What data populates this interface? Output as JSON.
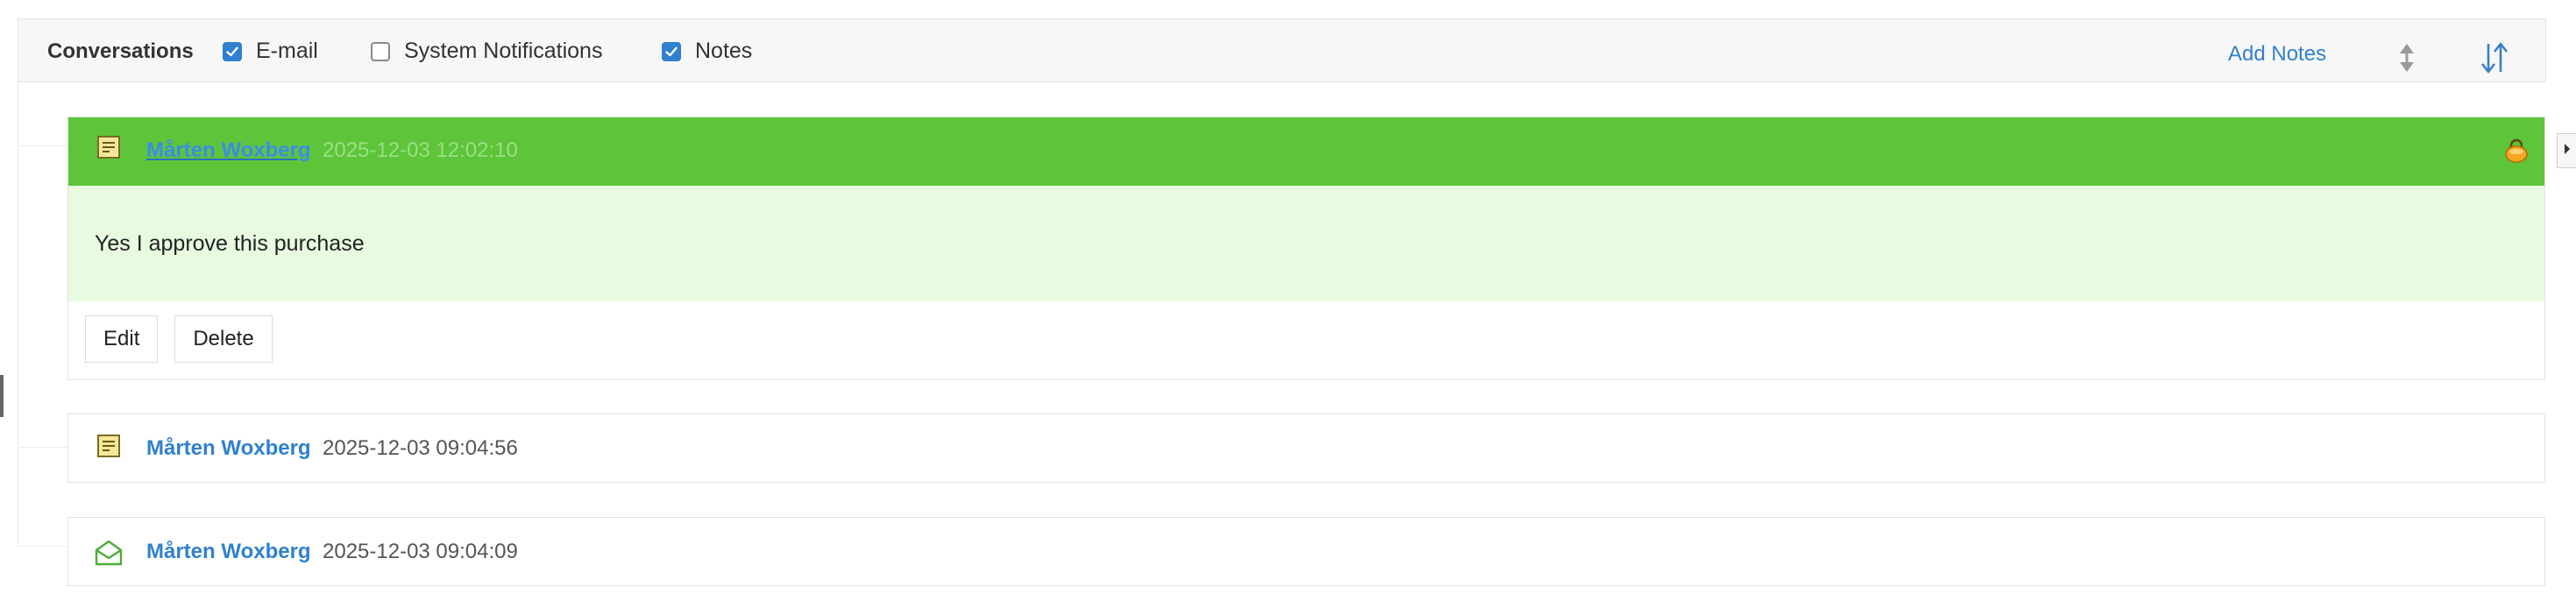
{
  "header": {
    "title": "Conversations",
    "filters": [
      {
        "label": "E-mail",
        "checked": true
      },
      {
        "label": "System Notifications",
        "checked": false
      },
      {
        "label": "Notes",
        "checked": true
      }
    ],
    "add_notes_label": "Add Notes",
    "sort_icon": "sort-up-down-icon",
    "order_icon": "sort-order-icon"
  },
  "conversations": [
    {
      "type": "note",
      "icon": "note-icon",
      "author": "Mårten Woxberg",
      "timestamp": "2025-12-03 12:02:10",
      "body": "Yes I approve this purchase",
      "expanded": true,
      "actions": {
        "edit_label": "Edit",
        "delete_label": "Delete"
      },
      "lock_icon": "lock-icon"
    },
    {
      "type": "note",
      "icon": "note-icon",
      "author": "Mårten Woxberg",
      "timestamp": "2025-12-03 09:04:56",
      "expanded": false
    },
    {
      "type": "email",
      "icon": "email-open-icon",
      "author": "Mårten Woxberg",
      "timestamp": "2025-12-03 09:04:09",
      "expanded": false
    }
  ],
  "colors": {
    "accent": "#2f80d0",
    "expanded_header": "#5ec43a",
    "expanded_body": "#e8fbe1",
    "email_icon": "#4caf35"
  }
}
